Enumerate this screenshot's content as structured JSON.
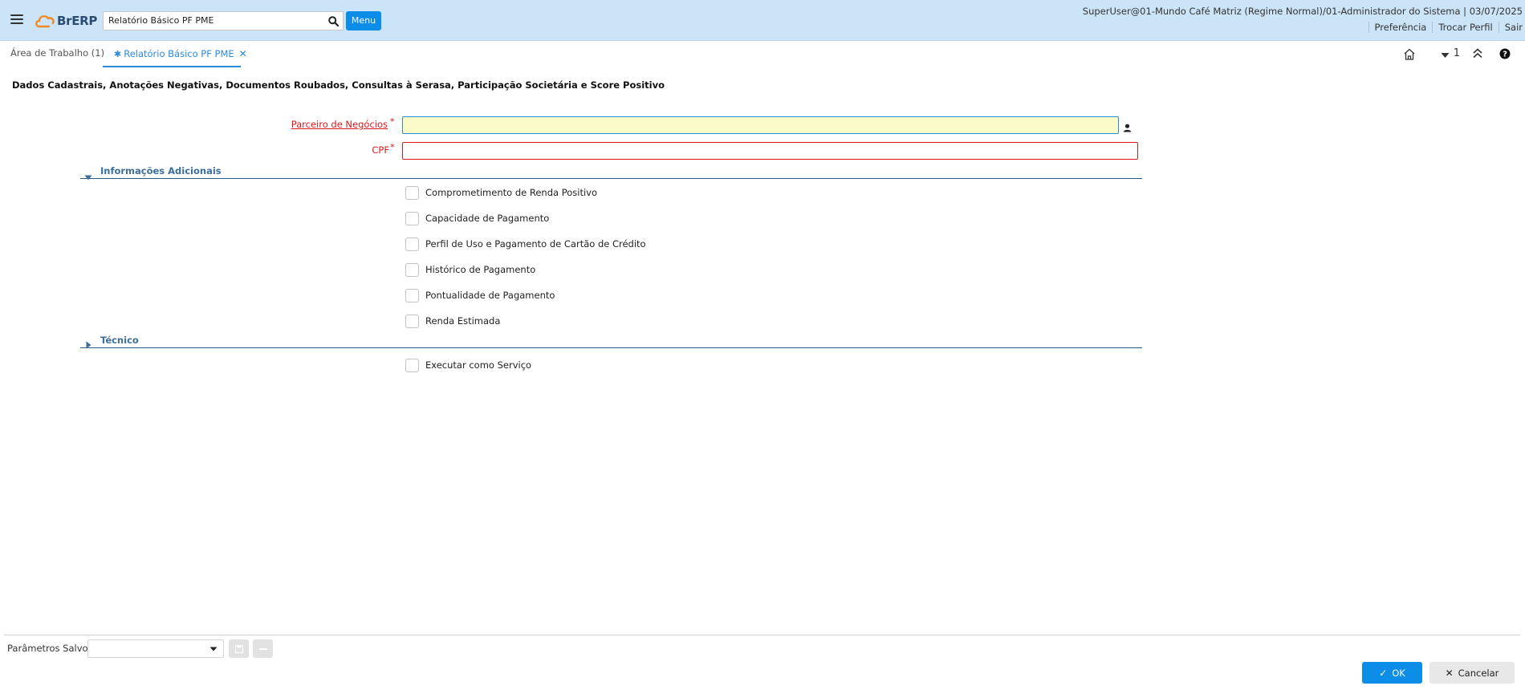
{
  "header": {
    "logo_text": "BrERP",
    "search_value": "Relatório Básico PF PME",
    "menu_label": "Menu",
    "user_info": "SuperUser@01-Mundo Café Matriz (Regime Normal)/01-Administrador do Sistema | 03/07/2025",
    "links": [
      "Preferência",
      "Trocar Perfil",
      "Sair"
    ]
  },
  "tabs": {
    "workspace": "Área de Trabalho (1)",
    "active": "Relatório Básico PF PME",
    "window_count": "1"
  },
  "form": {
    "title": "Dados Cadastrais, Anotações Negativas, Documentos Roubados, Consultas à Serasa, Participação Societária e Score Positivo",
    "business_partner_label": "Parceiro de Negócios",
    "business_partner_value": "",
    "cpf_label": "CPF",
    "cpf_value": "",
    "required_mark": "*",
    "sections": {
      "additional": "Informações Adicionais",
      "technical": "Técnico"
    },
    "checkboxes": [
      {
        "label": "Comprometimento de Renda Positivo",
        "checked": false
      },
      {
        "label": "Capacidade de Pagamento",
        "checked": false
      },
      {
        "label": "Perfil de Uso e Pagamento de Cartão de Crédito",
        "checked": false
      },
      {
        "label": "Histórico de Pagamento",
        "checked": false
      },
      {
        "label": "Pontualidade de Pagamento",
        "checked": false
      },
      {
        "label": "Renda Estimada",
        "checked": false
      }
    ],
    "technical_checkbox": {
      "label": "Executar como Serviço",
      "checked": false
    }
  },
  "footer": {
    "saved_params_label": "Parâmetros Salvos",
    "saved_params_value": "",
    "ok_label": "OK",
    "cancel_label": "Cancelar"
  },
  "colors": {
    "header_bg": "#cce4f7",
    "accent": "#0c8de8",
    "required": "#d9191c",
    "section_title": "#3c6f9d"
  }
}
